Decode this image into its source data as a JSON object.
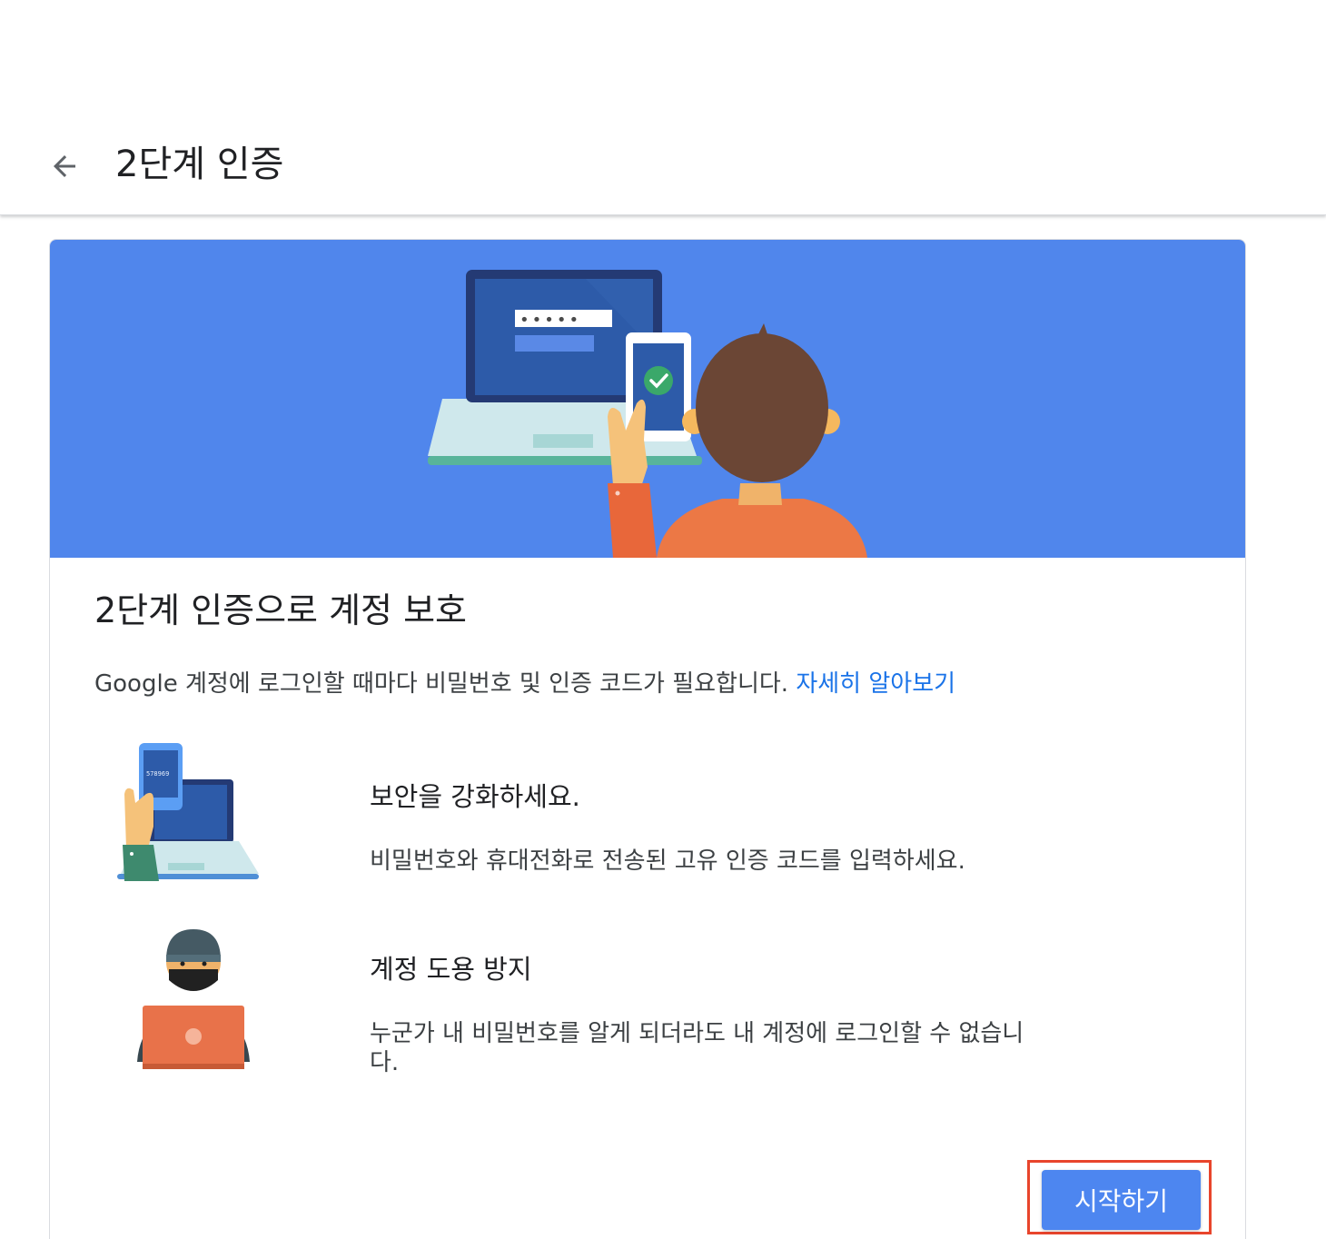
{
  "header": {
    "title": "2단계 인증",
    "back_icon": "arrow-back-icon"
  },
  "card": {
    "title": "2단계 인증으로 계정 보호",
    "description": "Google 계정에 로그인할 때마다 비밀번호 및 인증 코드가 필요합니다.",
    "learn_more_link": "자세히 알아보기",
    "hero": {
      "password_dots": "•••••"
    },
    "features": [
      {
        "title": "보안을 강화하세요.",
        "text": "비밀번호와 휴대전화로 전송된 고유 인증 코드를 입력하세요.",
        "illustration": "phone-code-laptop-illustration",
        "code": "578969"
      },
      {
        "title": "계정 도용 방지",
        "text": "누군가 내 비밀번호를 알게 되더라도 내 계정에 로그인할 수 없습니다.",
        "illustration": "hacker-laptop-illustration"
      }
    ]
  },
  "actions": {
    "start_label": "시작하기"
  },
  "colors": {
    "hero_bg": "#5086ec",
    "link": "#1a73e8",
    "button": "#4d86f0",
    "highlight": "#e8452c"
  }
}
